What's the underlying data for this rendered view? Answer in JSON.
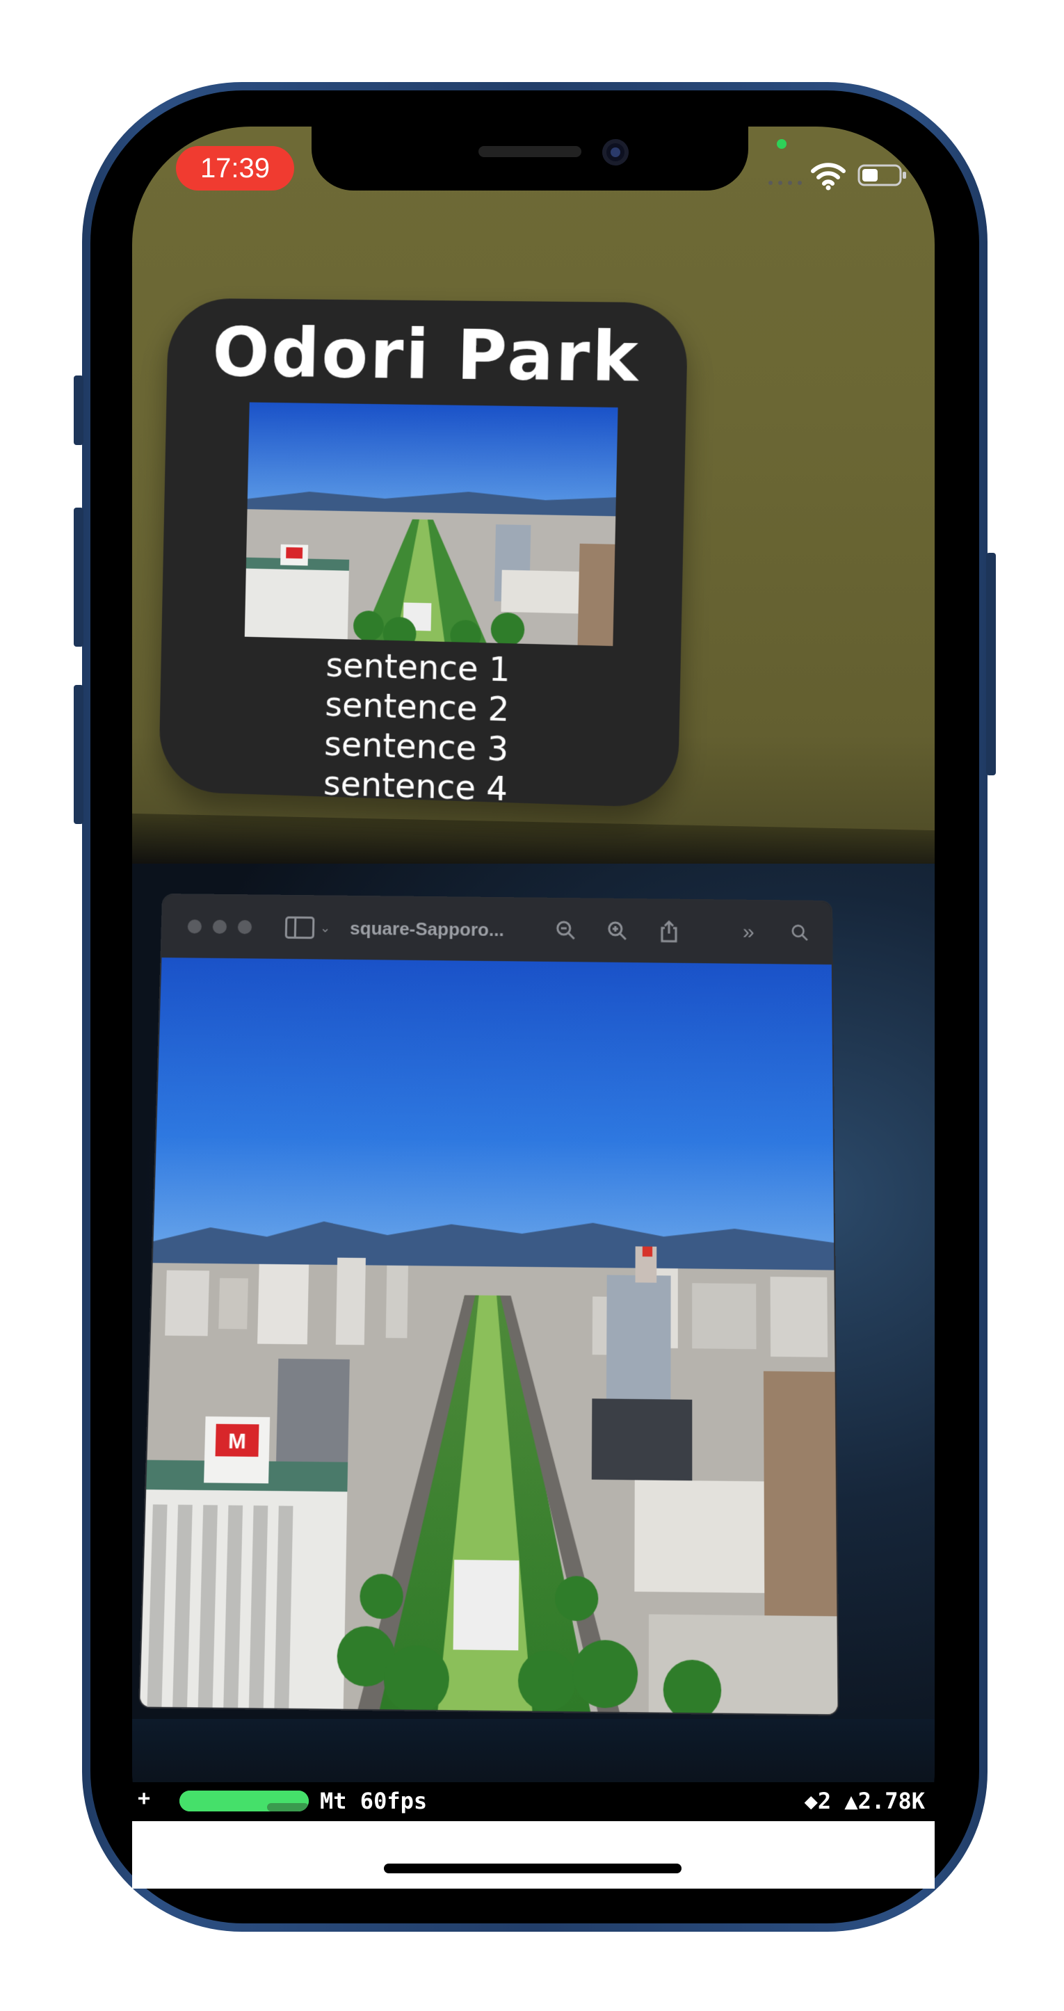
{
  "status_bar": {
    "time": "17:39",
    "icons": [
      "wifi-icon",
      "battery-icon"
    ]
  },
  "ar_card": {
    "title": "Odori Park",
    "sentences": [
      "sentence 1",
      "sentence 2",
      "sentence 3",
      "sentence 4"
    ]
  },
  "monitor_window": {
    "title": "square-Sapporo...",
    "toolbar_icons": [
      "sidebar-icon",
      "zoom-out-icon",
      "zoom-in-icon",
      "share-icon",
      "more-icon",
      "search-icon"
    ]
  },
  "debug_overlay": {
    "plus": "+",
    "fps_text": "Mt 60fps",
    "stats_text": "◆2 ▲2.78K",
    "fps_level": 1.0
  },
  "colors": {
    "time_pill": "#f03b30",
    "phone_frame": "#2c4f82",
    "fps_bar": "#45e06a",
    "card_bg": "#262626"
  }
}
